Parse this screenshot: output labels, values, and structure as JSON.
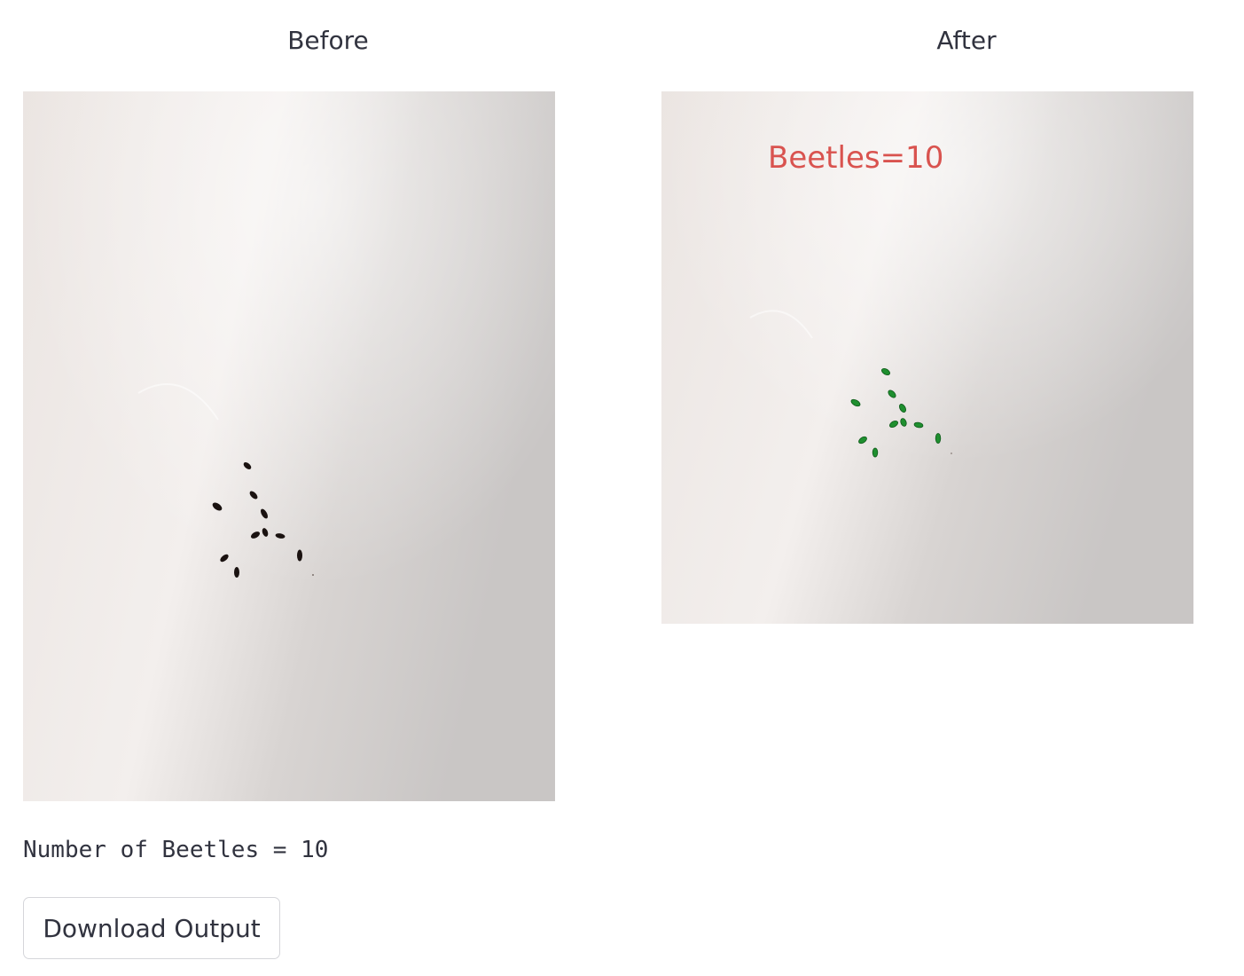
{
  "columns": {
    "before": {
      "title": "Before"
    },
    "after": {
      "title": "After",
      "overlay_label": "Beetles=10",
      "overlay_color": "#d9534f",
      "beetle_color": "#1f8f2f"
    }
  },
  "result": {
    "count_text": "Number of Beetles = 10"
  },
  "actions": {
    "download_label": "Download Output"
  },
  "colors": {
    "text": "#31333f",
    "paper": "#efeae7",
    "beetle_before": "#1a1210"
  }
}
